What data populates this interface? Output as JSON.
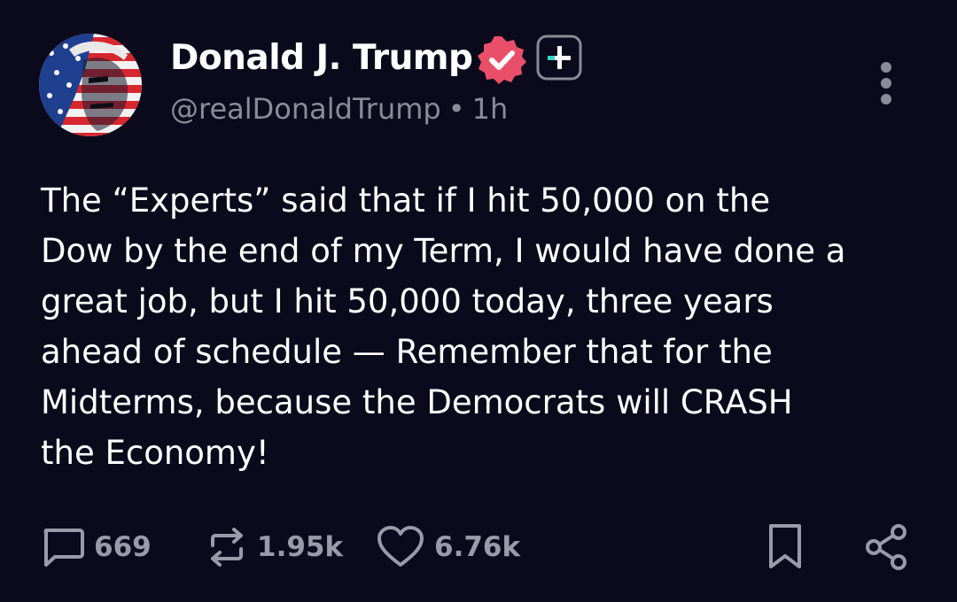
{
  "author": {
    "name": "Donald J. Trump",
    "handle": "@realDonaldTrump",
    "separator": "•",
    "time": "1h"
  },
  "icons": {
    "verified": "verified-badge-icon",
    "plus": "plus-badge-icon",
    "more": "more-vertical-icon",
    "reply": "reply-icon",
    "repost": "repost-icon",
    "like": "heart-icon",
    "bookmark": "bookmark-icon",
    "share": "share-icon"
  },
  "colors": {
    "background": "#0b0a1c",
    "verified": "#ea4f6a",
    "plus_accent": "#3ad4c2",
    "muted": "#8a8a99"
  },
  "post": {
    "lines": [
      "The “Experts” said that if I hit 50,000 on the",
      "Dow by the end of my Term, I would have done a",
      "great job, but I hit 50,000 today, three years",
      "ahead of schedule — Remember that for the",
      "Midterms, because the Democrats will CRASH",
      "the Economy!"
    ]
  },
  "actions": {
    "replies": "669",
    "reposts": "1.95k",
    "likes": "6.76k"
  }
}
